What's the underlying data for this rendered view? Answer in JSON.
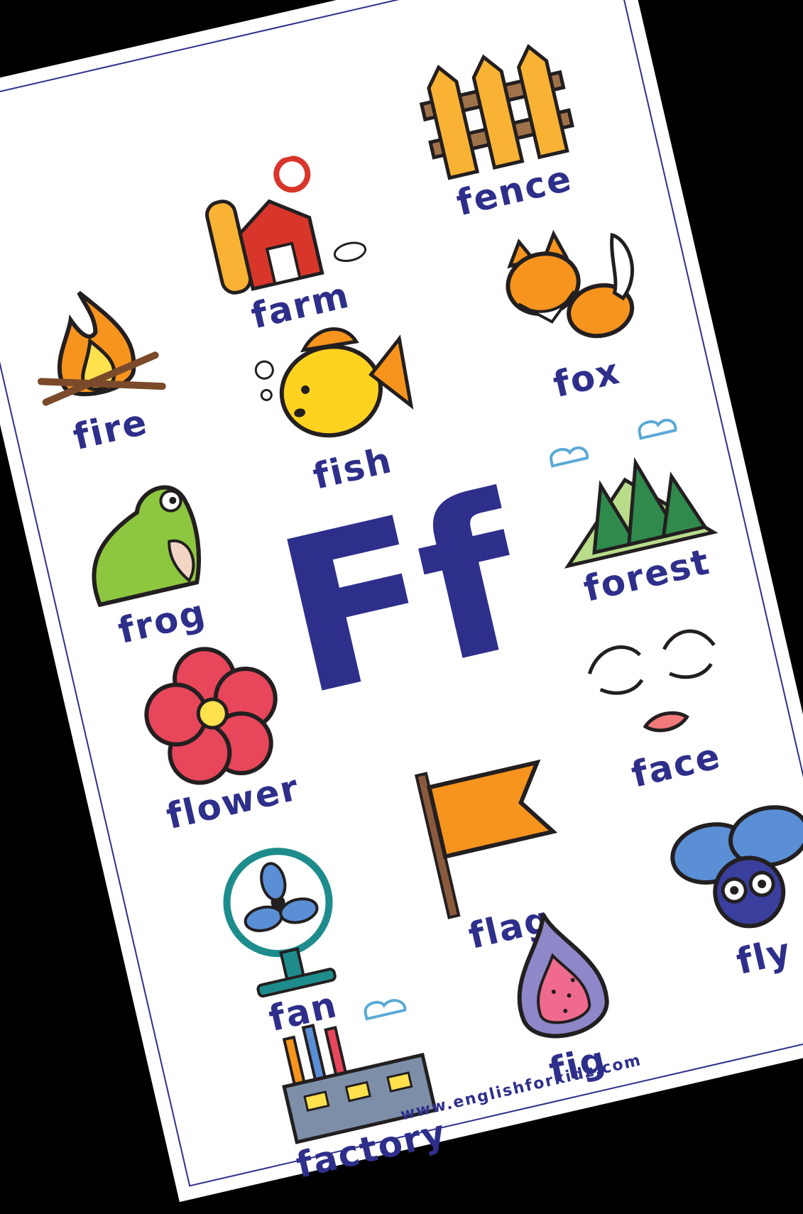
{
  "letter": "Ff",
  "words": {
    "fire": "fire",
    "farm": "farm",
    "fence": "fence",
    "fish": "fish",
    "fox": "fox",
    "frog": "frog",
    "forest": "forest",
    "flower": "flower",
    "face": "face",
    "flag": "flag",
    "fan": "fan",
    "fly": "fly",
    "fig": "fig",
    "factory": "factory"
  },
  "website": "www.englishforkidz.com",
  "colors": {
    "text": "#2e2f8a",
    "background": "#ffffff",
    "outside": "#000000"
  }
}
